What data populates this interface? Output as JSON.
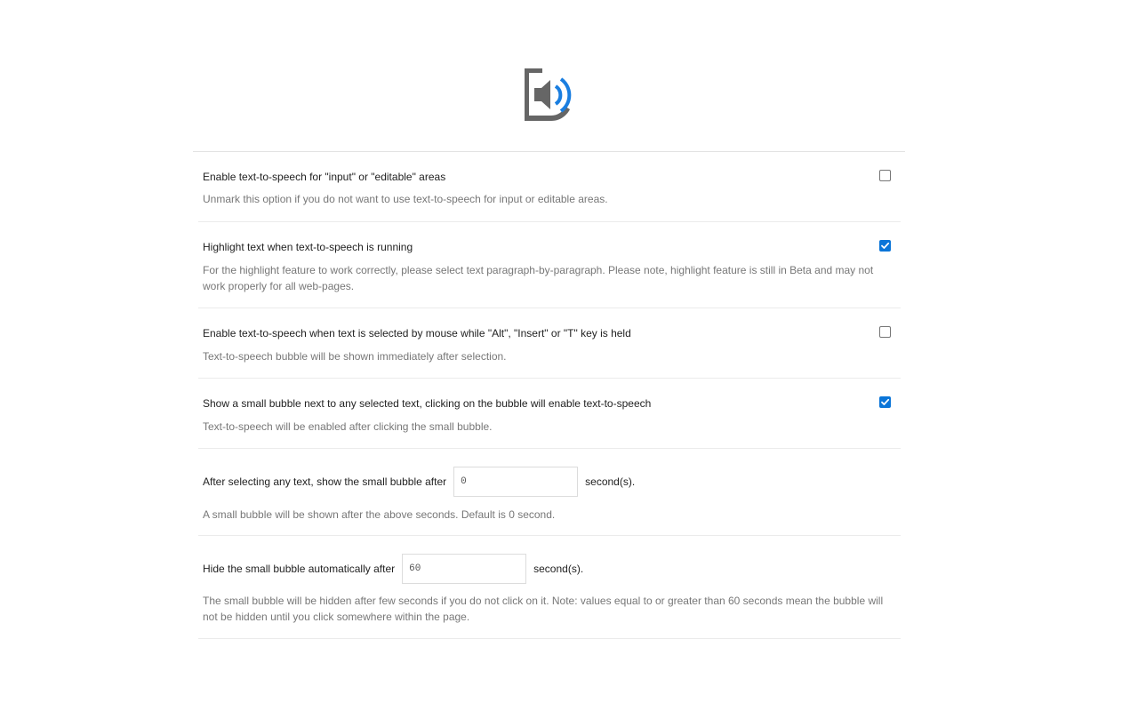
{
  "options": [
    {
      "title": "Enable text-to-speech for \"input\" or \"editable\" areas",
      "description": "Unmark this option if you do not want to use text-to-speech for input or editable areas.",
      "checked": false
    },
    {
      "title": "Highlight text when text-to-speech is running",
      "description": "For the highlight feature to work correctly, please select text paragraph-by-paragraph. Please note, highlight feature is still in Beta and may not work properly for all web-pages.",
      "checked": true
    },
    {
      "title": "Enable text-to-speech when text is selected by mouse while \"Alt\", \"Insert\" or \"T\" key is held",
      "description": "Text-to-speech bubble will be shown immediately after selection.",
      "checked": false
    },
    {
      "title": "Show a small bubble next to any selected text, clicking on the bubble will enable text-to-speech",
      "description": "Text-to-speech will be enabled after clicking the small bubble.",
      "checked": true
    }
  ],
  "bubble_delay": {
    "label": "After selecting any text, show the small bubble after",
    "value": "0",
    "unit": "second(s).",
    "description": "A small bubble will be shown after the above seconds. Default is 0 second."
  },
  "bubble_hide": {
    "label": "Hide the small bubble automatically after",
    "value": "60",
    "unit": "second(s).",
    "description": "The small bubble will be hidden after few seconds if you do not click on it. Note: values equal to or greater than 60 seconds mean the bubble will not be hidden until you click somewhere within the page."
  },
  "colors": {
    "accent": "#0b75d8",
    "logo_gray": "#666666",
    "logo_blue": "#1a7ee0"
  },
  "icons": {
    "logo": "speaker-document-icon",
    "checkmark": "checkmark-icon"
  }
}
